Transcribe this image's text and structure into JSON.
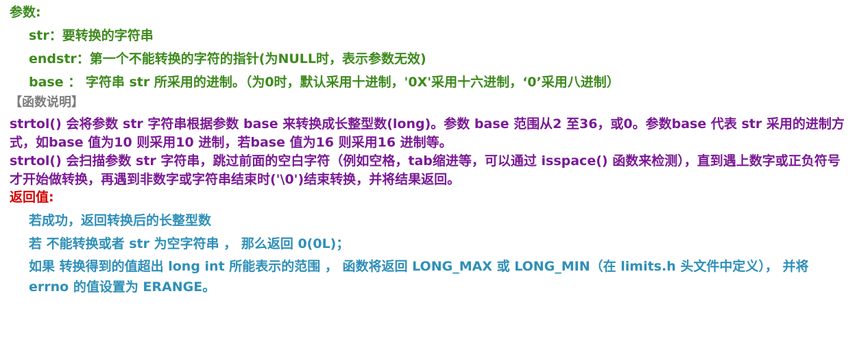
{
  "params": {
    "heading": "参数:",
    "items": [
      "str：要转换的字符串",
      "endstr：第一个不能转换的字符的指针(为NULL时，表示参数无效)",
      "base ： 字符串 str 所采用的进制。（为0时，默认采用十进制，'0X'采用十六进制，‘0’采用八进制）"
    ]
  },
  "description": {
    "heading": "【函数说明】",
    "paragraphs": [
      "strtol() 会将参数 str 字符串根据参数 base 来转换成长整型数(long)。参数 base 范围从2 至36，或0。参数base 代表 str 采用的进制方式，如base 值为10 则采用10 进制，若base 值为16 则采用16 进制等。",
      "strtol() 会扫描参数 str 字符串，跳过前面的空白字符（例如空格，tab缩进等，可以通过 isspace() 函数来检测），直到遇上数字或正负符号才开始做转换，再遇到非数字或字符串结束时('\\0')结束转换，并将结果返回。"
    ]
  },
  "return_value": {
    "heading": "返回值:",
    "items": [
      "若成功，返回转换后的长整型数",
      "若 不能转换或者 str 为空字符串 ， 那么返回 0(0L)；",
      "如果 转换得到的值超出 long int 所能表示的范围 ， 函数将返回 LONG_MAX 或 LONG_MIN（在 limits.h 头文件中定义）， 并将 errno 的值设置为 ERANGE。"
    ]
  }
}
